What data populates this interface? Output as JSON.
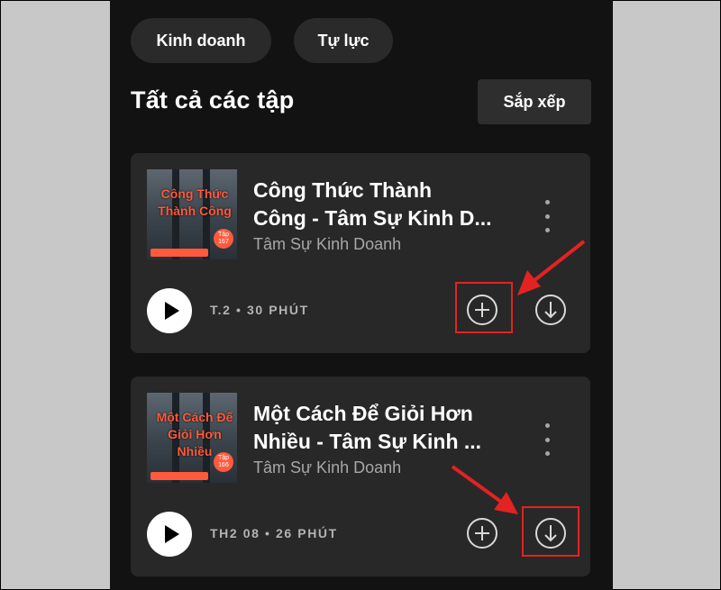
{
  "filters": [
    "Kinh doanh",
    "Tự lực"
  ],
  "section": {
    "title": "Tất cả các tập",
    "sort_label": "Sắp xếp"
  },
  "episodes": [
    {
      "title_line1": "Công Thức Thành",
      "title_line2": "Công - Tâm Sự Kinh D...",
      "show": "Tâm Sự Kinh Doanh",
      "meta": "T.2 • 30 PHÚT",
      "cover_text": "Công Thức Thành Công",
      "cover_badge": "Tập 167"
    },
    {
      "title_line1": "Một Cách Để Giỏi Hơn",
      "title_line2": "Nhiều - Tâm Sự Kinh ...",
      "show": "Tâm Sự Kinh Doanh",
      "meta": "TH2 08 • 26 PHÚT",
      "cover_text": "Một Cách Để Giỏi Hơn Nhiều",
      "cover_badge": "Tập 166"
    }
  ],
  "icons": {
    "more": "more-vertical-icon",
    "play": "play-icon",
    "add": "add-circle-icon",
    "download": "download-circle-icon"
  },
  "colors": {
    "background": "#121212",
    "card": "#282828",
    "accent_cover": "#ff5a3c",
    "highlight": "#e32222"
  }
}
